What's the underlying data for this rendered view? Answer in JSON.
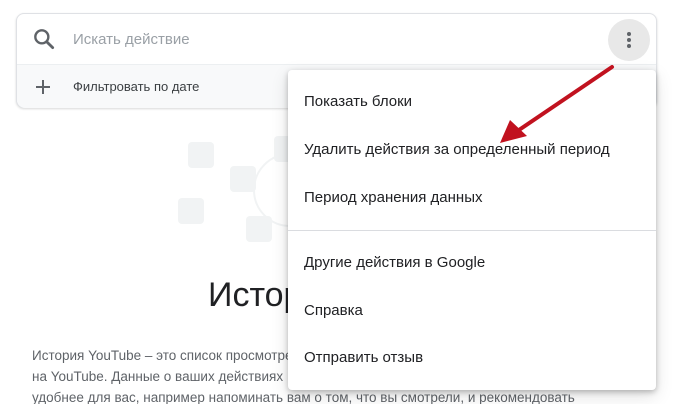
{
  "search": {
    "placeholder": "Искать действие",
    "icon": "search-icon"
  },
  "filter": {
    "label": "Фильтровать по дате",
    "icon": "plus-icon"
  },
  "more_button": {
    "icon": "more-vert-icon"
  },
  "menu": {
    "items": [
      {
        "label": "Показать блоки"
      },
      {
        "label": "Удалить действия за определенный период"
      },
      {
        "label": "Период хранения данных"
      },
      {
        "label": "Другие действия в Google"
      },
      {
        "label": "Справка"
      },
      {
        "label": "Отправить отзыв"
      }
    ]
  },
  "page": {
    "title": "История",
    "description_lines": [
      "История YouTube – это список просмотренных вами видео",
      "на YouTube. Данные о ваших действиях",
      "удобнее для вас, например напоминать вам о том, что вы смотрели, и рекомендовать"
    ]
  },
  "colors": {
    "annotation_arrow": "#c1121f",
    "menu_background": "#ffffff",
    "more_button_background": "#e8e8e8"
  }
}
